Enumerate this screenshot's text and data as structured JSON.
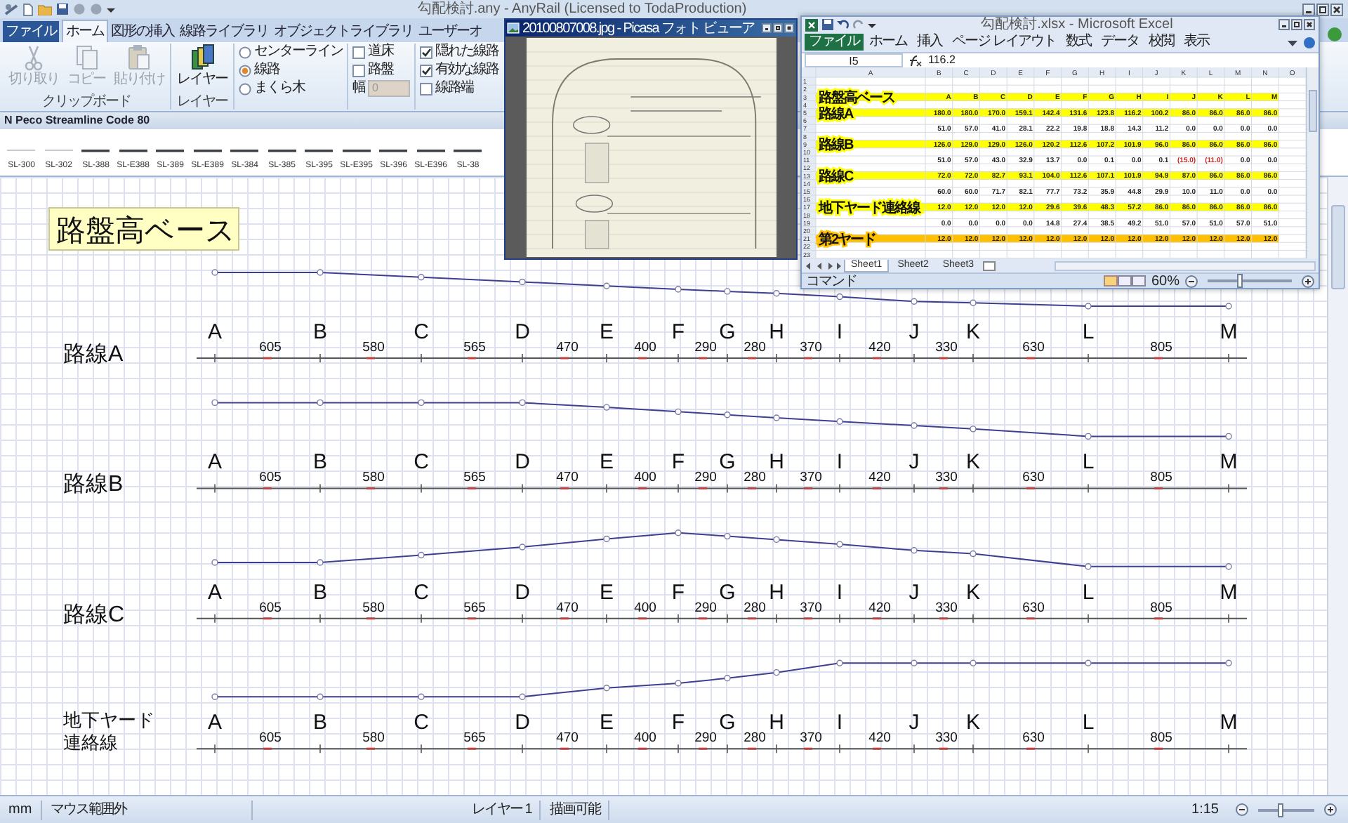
{
  "title_bar": {
    "title": "勾配検討.any - AnyRail (Licensed to TodaProduction)"
  },
  "ribbon": {
    "tabs": [
      {
        "label": "ファイル",
        "kind": "file",
        "selected": false
      },
      {
        "label": "ホーム",
        "kind": "tab",
        "selected": true
      },
      {
        "label": "図形の挿入",
        "kind": "tab",
        "selected": false
      },
      {
        "label": "線路ライブラリ",
        "kind": "tab",
        "selected": false
      },
      {
        "label": "オブジェクトライブラリ",
        "kind": "tab",
        "selected": false
      },
      {
        "label": "ユーザーオ",
        "kind": "tab",
        "selected": false
      }
    ],
    "clipboard": {
      "buttons": [
        {
          "label": "切り取り",
          "kind": "cut",
          "disabled": true
        },
        {
          "label": "コピー",
          "kind": "copy",
          "disabled": true
        },
        {
          "label": "貼り付け",
          "kind": "paste",
          "disabled": true
        }
      ],
      "group_label": "クリップボード"
    },
    "layer": {
      "button": "レイヤー",
      "group_label": "レイヤー"
    },
    "draw_modes": [
      {
        "label": "センターライン",
        "selected": false
      },
      {
        "label": "線路",
        "selected": true
      },
      {
        "label": "まくら木",
        "selected": false
      }
    ],
    "bed_options": [
      {
        "label": "道床",
        "checked": false
      },
      {
        "label": "路盤",
        "checked": false
      }
    ],
    "width_field": {
      "label": "幅",
      "value": "0",
      "disabled": true
    },
    "track_options": [
      {
        "label": "隠れた線路",
        "checked": true
      },
      {
        "label": "有効な線路",
        "checked": true
      },
      {
        "label": "線路端",
        "checked": false
      }
    ]
  },
  "library": {
    "title": "N Peco Streamline Code 80",
    "pieces": [
      "SL-300",
      "SL-302",
      "SL-388",
      "SL-E388",
      "SL-389",
      "SL-E389",
      "SL-384",
      "SL-385",
      "SL-395",
      "SL-E395",
      "SL-396",
      "SL-E396",
      "SL-38"
    ]
  },
  "canvas": {
    "base_label": "路盤高ベース",
    "tracks": [
      {
        "name_lines": [
          "路線A"
        ],
        "points": [
          "A",
          "B",
          "C",
          "D",
          "E",
          "F",
          "G",
          "H",
          "I",
          "J",
          "K",
          "L",
          "M"
        ],
        "distances": [
          "605",
          "580",
          "565",
          "470",
          "400",
          "290",
          "280",
          "370",
          "420",
          "330",
          "630",
          "805"
        ]
      },
      {
        "name_lines": [
          "路線B"
        ],
        "points": [
          "A",
          "B",
          "C",
          "D",
          "E",
          "F",
          "G",
          "H",
          "I",
          "J",
          "K",
          "L",
          "M"
        ],
        "distances": [
          "605",
          "580",
          "565",
          "470",
          "400",
          "290",
          "280",
          "370",
          "420",
          "330",
          "630",
          "805"
        ]
      },
      {
        "name_lines": [
          "路線C"
        ],
        "points": [
          "A",
          "B",
          "C",
          "D",
          "E",
          "F",
          "G",
          "H",
          "I",
          "J",
          "K",
          "L",
          "M"
        ],
        "distances": [
          "605",
          "580",
          "565",
          "470",
          "400",
          "290",
          "280",
          "370",
          "420",
          "330",
          "630",
          "805"
        ]
      },
      {
        "name_lines": [
          "地下ヤード",
          "連絡線"
        ],
        "points": [
          "A",
          "B",
          "C",
          "D",
          "E",
          "F",
          "G",
          "H",
          "I",
          "J",
          "K",
          "L",
          "M"
        ],
        "distances": [
          "605",
          "580",
          "565",
          "470",
          "400",
          "290",
          "280",
          "370",
          "420",
          "330",
          "630",
          "805"
        ]
      }
    ]
  },
  "status_bar": {
    "segments": [
      "mm",
      "マウス範囲外",
      "レイヤー 1",
      "描画可能"
    ],
    "scale": "1:15",
    "zoom_slider": {
      "level": 0.4
    }
  },
  "picasa": {
    "title": "20100807008.jpg - Picasa フォト ビューア"
  },
  "excel": {
    "title": "勾配検討.xlsx - Microsoft Excel",
    "tabs": [
      {
        "label": "ファイル",
        "kind": "file"
      },
      {
        "label": "ホーム",
        "kind": "tab"
      },
      {
        "label": "挿入",
        "kind": "tab"
      },
      {
        "label": "ページ レイアウト",
        "kind": "tab"
      },
      {
        "label": "数式",
        "kind": "tab"
      },
      {
        "label": "データ",
        "kind": "tab"
      },
      {
        "label": "校閲",
        "kind": "tab"
      },
      {
        "label": "表示",
        "kind": "tab"
      }
    ],
    "name_box": "I5",
    "formula": "116.2",
    "columns": [
      "A",
      "B",
      "C",
      "D",
      "E",
      "F",
      "G",
      "H",
      "I",
      "J",
      "K",
      "L",
      "M",
      "N",
      "O"
    ],
    "rows": [
      {
        "number": "1"
      },
      {
        "number": "2"
      },
      {
        "number": "3",
        "label": "路盤高ベース",
        "color": "#ffff00",
        "values": [
          "A",
          "B",
          "C",
          "D",
          "E",
          "F",
          "G",
          "H",
          "I",
          "J",
          "K",
          "L",
          "M"
        ]
      },
      {
        "number": "4"
      },
      {
        "number": "5",
        "label": "路線A",
        "color": "#ffff00",
        "values": [
          "180.0",
          "180.0",
          "170.0",
          "159.1",
          "142.4",
          "131.6",
          "123.8",
          "116.2",
          "100.2",
          "86.0",
          "86.0",
          "86.0",
          "86.0"
        ]
      },
      {
        "number": "6"
      },
      {
        "number": "7",
        "values": [
          "51.0",
          "57.0",
          "41.0",
          "28.1",
          "22.2",
          "19.8",
          "18.8",
          "14.3",
          "11.2",
          "0.0",
          "0.0",
          "0.0",
          "0.0"
        ]
      },
      {
        "number": "8"
      },
      {
        "number": "9",
        "label": "路線B",
        "color": "#ffff00",
        "values": [
          "126.0",
          "129.0",
          "129.0",
          "126.0",
          "120.2",
          "112.6",
          "107.2",
          "101.9",
          "96.0",
          "86.0",
          "86.0",
          "86.0",
          "86.0"
        ]
      },
      {
        "number": "10"
      },
      {
        "number": "11",
        "values": [
          "51.0",
          "57.0",
          "43.0",
          "32.9",
          "13.7",
          "0.0",
          "0.1",
          "0.0",
          "0.1",
          "(15.0)",
          "(11.0)",
          "0.0",
          "0.0"
        ],
        "negative": [
          false,
          false,
          false,
          false,
          false,
          false,
          false,
          false,
          false,
          true,
          true,
          false,
          false
        ]
      },
      {
        "number": "12"
      },
      {
        "number": "13",
        "label": "路線C",
        "color": "#ffff00",
        "values": [
          "72.0",
          "72.0",
          "82.7",
          "93.1",
          "104.0",
          "112.6",
          "107.1",
          "101.9",
          "94.9",
          "87.0",
          "86.0",
          "86.0",
          "86.0"
        ]
      },
      {
        "number": "14"
      },
      {
        "number": "15",
        "values": [
          "60.0",
          "60.0",
          "71.7",
          "82.1",
          "77.7",
          "73.2",
          "35.9",
          "44.8",
          "29.9",
          "10.0",
          "11.0",
          "0.0",
          "0.0"
        ]
      },
      {
        "number": "16"
      },
      {
        "number": "17",
        "label": "地下ヤード連絡線",
        "color": "#ffff00",
        "values": [
          "12.0",
          "12.0",
          "12.0",
          "12.0",
          "29.6",
          "39.6",
          "48.3",
          "57.2",
          "86.0",
          "86.0",
          "86.0",
          "86.0",
          "86.0"
        ]
      },
      {
        "number": "18"
      },
      {
        "number": "19",
        "values": [
          "0.0",
          "0.0",
          "0.0",
          "0.0",
          "14.8",
          "27.4",
          "38.5",
          "49.2",
          "51.0",
          "57.0",
          "51.0",
          "57.0",
          "51.0"
        ]
      },
      {
        "number": "20"
      },
      {
        "number": "21",
        "label": "第2ヤード",
        "color": "#ffc000",
        "values": [
          "12.0",
          "12.0",
          "12.0",
          "12.0",
          "12.0",
          "12.0",
          "12.0",
          "12.0",
          "12.0",
          "12.0",
          "12.0",
          "12.0",
          "12.0"
        ]
      },
      {
        "number": "22"
      },
      {
        "number": "23"
      }
    ],
    "sheets": [
      {
        "label": "Sheet1",
        "selected": true
      },
      {
        "label": "Sheet2",
        "selected": false
      },
      {
        "label": "Sheet3",
        "selected": false
      }
    ],
    "status": "コマンド",
    "zoom": "60%",
    "zoom_slider": {
      "level": 0.38
    }
  }
}
